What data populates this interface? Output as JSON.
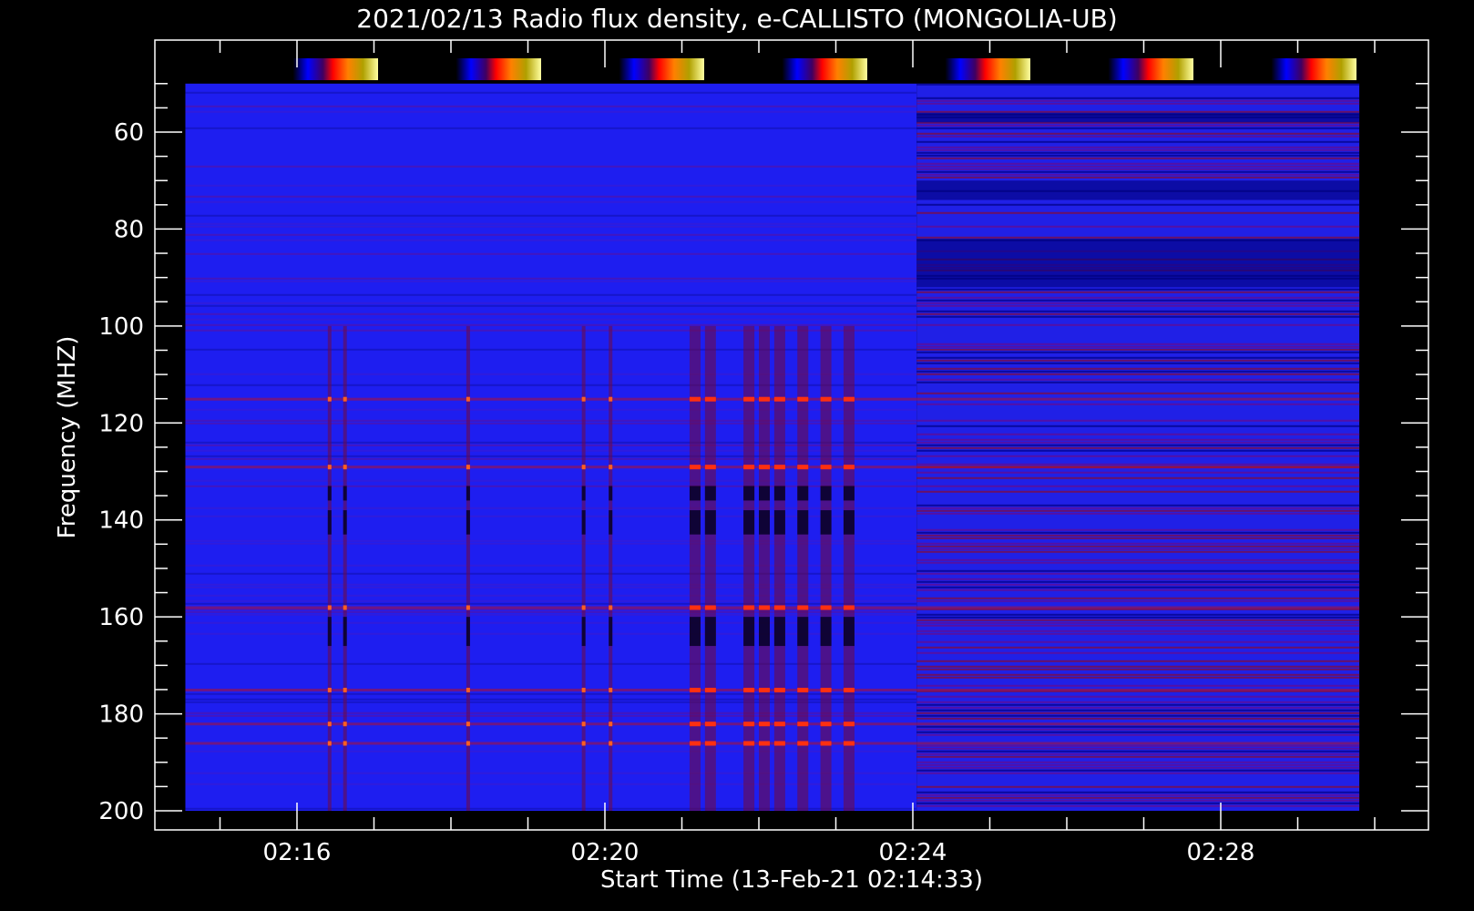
{
  "chart_data": {
    "type": "heatmap",
    "title": "2021/02/13  Radio flux density, e-CALLISTO (MONGOLIA-UB)",
    "xlabel": "Start Time (13-Feb-21 02:14:33)",
    "ylabel": "Frequency (MHZ)",
    "x_ticks": [
      "02:16",
      "02:20",
      "02:24",
      "02:28"
    ],
    "y_ticks": [
      "60",
      "80",
      "100",
      "120",
      "140",
      "160",
      "180",
      "200"
    ],
    "y_tick_values": [
      60,
      80,
      100,
      120,
      140,
      160,
      180,
      200
    ],
    "ylim": [
      45,
      205
    ],
    "ydata_range": [
      50,
      200
    ],
    "x_tick_minutes": [
      16,
      20,
      24,
      28
    ],
    "xdata_range_minutes": [
      14.55,
      29.8
    ],
    "y_inverted": true,
    "colorscale": [
      "#000000",
      "#0000ff",
      "#ff0000",
      "#ffa000",
      "#ffff00",
      "#ffffff"
    ],
    "colorbar_count": 7,
    "segments": [
      {
        "start_minute": 14.55,
        "end_minute": 24.05,
        "background": "#1e1ef0"
      },
      {
        "start_minute": 24.05,
        "end_minute": 29.8,
        "background": "#2020e6"
      }
    ],
    "burst_columns_minutes": [
      16.4,
      16.6,
      18.2,
      19.7,
      20.05,
      21.1,
      21.3,
      21.8,
      22.0,
      22.2,
      22.5,
      22.8,
      23.1
    ],
    "bright_bands_mhz": [
      115,
      129,
      158,
      175,
      182,
      186
    ]
  }
}
